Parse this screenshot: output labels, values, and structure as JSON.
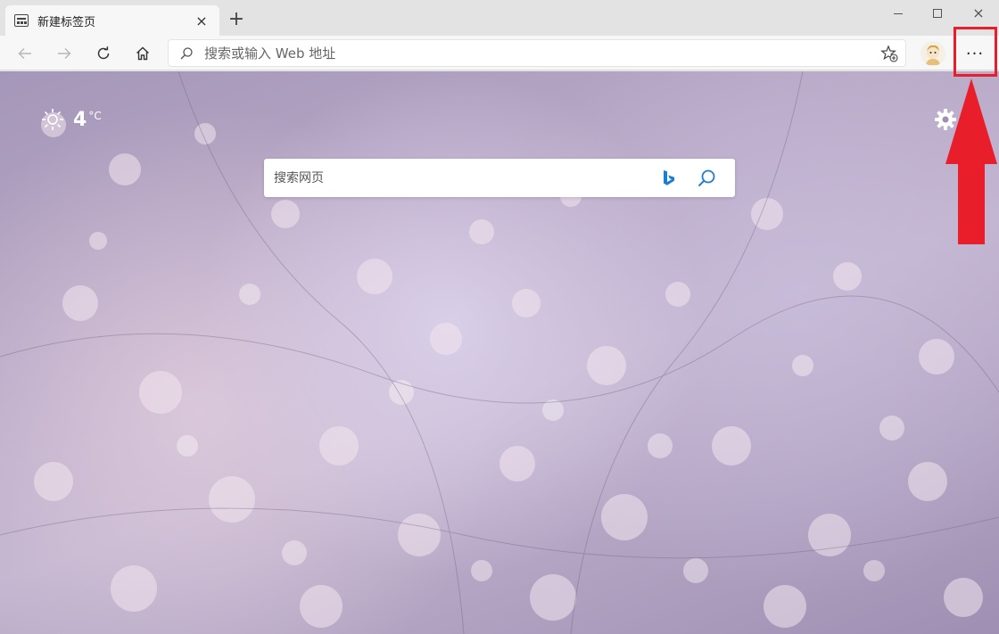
{
  "tab": {
    "title": "新建标签页",
    "icon": "page-icon",
    "close": "×"
  },
  "new_tab": {
    "label": "+"
  },
  "window": {
    "minimize": "minimize-icon",
    "maximize": "maximize-icon",
    "close": "×"
  },
  "toolbar": {
    "back": "arrow-left-icon",
    "forward": "arrow-right-icon",
    "refresh": "refresh-icon",
    "home": "home-icon",
    "address_placeholder": "搜索或输入 Web 地址",
    "favorite": "star-add-icon",
    "more_label": "···"
  },
  "weather": {
    "temp": "4",
    "unit": "°C",
    "icon": "sun-icon"
  },
  "search": {
    "placeholder": "搜索网页",
    "engine_icon": "bing-icon",
    "go_icon": "search-icon"
  },
  "annotation": {
    "color": "#e81f2a"
  }
}
